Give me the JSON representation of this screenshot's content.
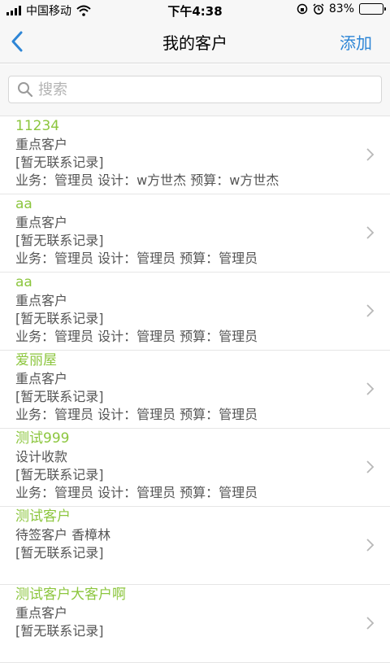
{
  "status": {
    "carrier": "中国移动",
    "time": "下午4:38",
    "battery": "83%",
    "battery_level": 0.83
  },
  "nav": {
    "title": "我的客户",
    "add_label": "添加"
  },
  "search": {
    "placeholder": "搜索"
  },
  "customers": [
    {
      "name": "11234",
      "line1": "重点客户",
      "line2": "[暂无联系记录]",
      "line3": "业务：管理员  设计：w方世杰  预算：w方世杰"
    },
    {
      "name": "aa",
      "line1": "重点客户",
      "line2": "[暂无联系记录]",
      "line3": "业务：管理员  设计：管理员  预算：管理员"
    },
    {
      "name": "aa",
      "line1": "重点客户",
      "line2": "[暂无联系记录]",
      "line3": "业务：管理员  设计：管理员  预算：管理员"
    },
    {
      "name": "爱丽屋",
      "line1": "重点客户",
      "line2": "[暂无联系记录]",
      "line3": "业务：管理员  设计：管理员  预算：管理员"
    },
    {
      "name": "测试999",
      "line1": "设计收款",
      "line2": "[暂无联系记录]",
      "line3": "业务：管理员  设计：管理员  预算：管理员"
    },
    {
      "name": "测试客户",
      "line1": "待签客户  香樟林",
      "line2": "[暂无联系记录]",
      "line3": ""
    },
    {
      "name": "测试客户大客户啊",
      "line1": "重点客户",
      "line2": "[暂无联系记录]",
      "line3": ""
    }
  ],
  "colors": {
    "accent_blue": "#2e86d6",
    "name_green": "#8cc63e"
  },
  "icons": {
    "back": "chevron-left-icon",
    "search": "search-icon",
    "row": "chevron-right-icon"
  }
}
